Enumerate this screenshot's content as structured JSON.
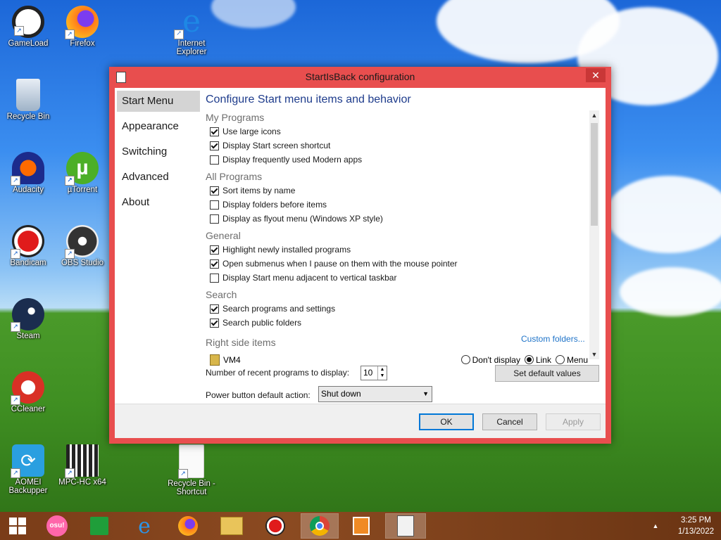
{
  "desktop": {
    "icons": [
      {
        "label": "GameLoad"
      },
      {
        "label": "Firefox"
      },
      {
        "label": "Internet Explorer"
      },
      {
        "label": "Recycle Bin"
      },
      {
        "label": "Audacity"
      },
      {
        "label": "µTorrent"
      },
      {
        "label": "Bandicam"
      },
      {
        "label": "OBS Studio"
      },
      {
        "label": "Steam"
      },
      {
        "label": "CCleaner"
      },
      {
        "label": "AOMEI Backupper"
      },
      {
        "label": "MPC-HC x64"
      },
      {
        "label": "Recycle Bin - Shortcut"
      }
    ]
  },
  "window": {
    "title": "StartIsBack configuration",
    "close_glyph": "✕",
    "nav": [
      {
        "label": "Start Menu"
      },
      {
        "label": "Appearance"
      },
      {
        "label": "Switching"
      },
      {
        "label": "Advanced"
      },
      {
        "label": "About"
      }
    ],
    "heading": "Configure Start menu items and behavior",
    "groups": {
      "my_programs": "My Programs",
      "all_programs": "All Programs",
      "general": "General",
      "search": "Search",
      "right_side": "Right side items"
    },
    "options": {
      "large_icons": {
        "label": "Use large icons",
        "checked": true
      },
      "start_screen_shortcut": {
        "label": "Display Start screen shortcut",
        "checked": true
      },
      "modern_apps": {
        "label": "Display frequently used Modern apps",
        "checked": false
      },
      "sort_by_name": {
        "label": "Sort items by name",
        "checked": true
      },
      "folders_before": {
        "label": "Display folders before items",
        "checked": false
      },
      "flyout": {
        "label": "Display as flyout menu (Windows XP style)",
        "checked": false
      },
      "highlight_new": {
        "label": "Highlight newly installed programs",
        "checked": true
      },
      "open_submenus": {
        "label": "Open submenus when I pause on them with the mouse pointer",
        "checked": true
      },
      "adjacent_taskbar": {
        "label": "Display Start menu adjacent to vertical taskbar",
        "checked": false
      },
      "search_programs": {
        "label": "Search programs and settings",
        "checked": true
      },
      "search_public": {
        "label": "Search public folders",
        "checked": true
      }
    },
    "custom_folders_link": "Custom folders...",
    "right_item": {
      "name": "VM4",
      "options": [
        "Don't display",
        "Link",
        "Menu"
      ],
      "selected": "Link"
    },
    "recent_label": "Number of recent programs to display:",
    "recent_value": "10",
    "set_default_button": "Set default values",
    "power_label": "Power button default action:",
    "power_value": "Shut down",
    "ok_button": "OK",
    "cancel_button": "Cancel",
    "apply_button": "Apply"
  },
  "taskbar": {
    "osu_label": "osu!",
    "tray_arrow": "▲",
    "time": "3:25 PM",
    "date": "1/13/2022"
  },
  "colors": {
    "window_border": "#e84e4e",
    "heading": "#1e3c8c",
    "link": "#1e73c8",
    "taskbar": "#7a3c18"
  }
}
